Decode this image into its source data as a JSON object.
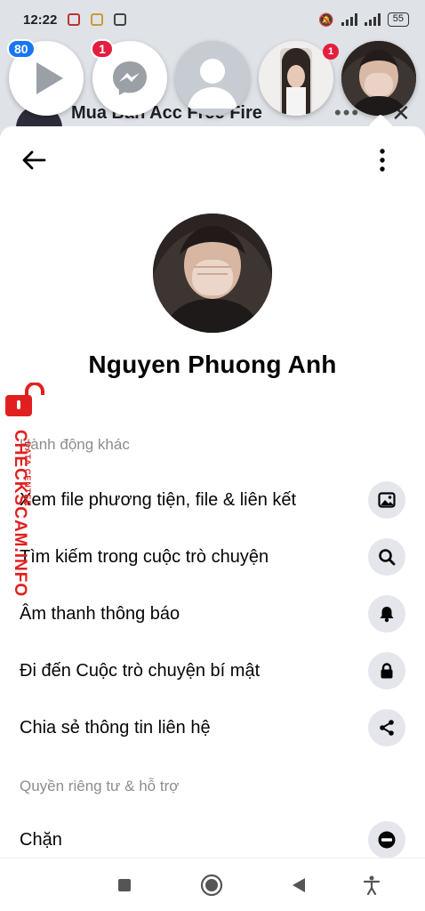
{
  "status_bar": {
    "time": "12:22",
    "battery": "55"
  },
  "background_app": {
    "title": "Mua Bán Acc Free Fire",
    "more": "•••",
    "close": "✕"
  },
  "chat_heads": [
    {
      "name": "video-head",
      "badge": "80"
    },
    {
      "name": "messenger-head",
      "badge": "1"
    },
    {
      "name": "default-avatar-head",
      "badge": ""
    },
    {
      "name": "girl-photo-head",
      "badge": "1"
    },
    {
      "name": "active-profile-head",
      "badge": ""
    }
  ],
  "profile": {
    "name": "Nguyen Phuong Anh"
  },
  "sections": {
    "more_actions": "Hành động khác",
    "privacy_support": "Quyền riêng tư & hỗ trợ"
  },
  "actions": [
    {
      "label": "Xem file phương tiện, file & liên kết",
      "icon": "image-icon"
    },
    {
      "label": "Tìm kiếm trong cuộc trò chuyện",
      "icon": "search-icon"
    },
    {
      "label": "Âm thanh thông báo",
      "icon": "bell-icon"
    },
    {
      "label": "Đi đến Cuộc trò chuyện bí mật",
      "icon": "lock-icon"
    },
    {
      "label": "Chia sẻ thông tin liên hệ",
      "icon": "share-icon"
    }
  ],
  "privacy_actions": [
    {
      "label": "Chặn",
      "icon": "block-icon"
    }
  ],
  "watermark": {
    "brand": "CHECKSCAM.INFO",
    "sub": "DATA CENTER"
  },
  "colors": {
    "accent": "#1877f2",
    "badge_red": "#e41e3f",
    "icon_bg": "#e4e6eb",
    "section_gray": "#8a8d91",
    "watermark_red": "#e02020"
  }
}
